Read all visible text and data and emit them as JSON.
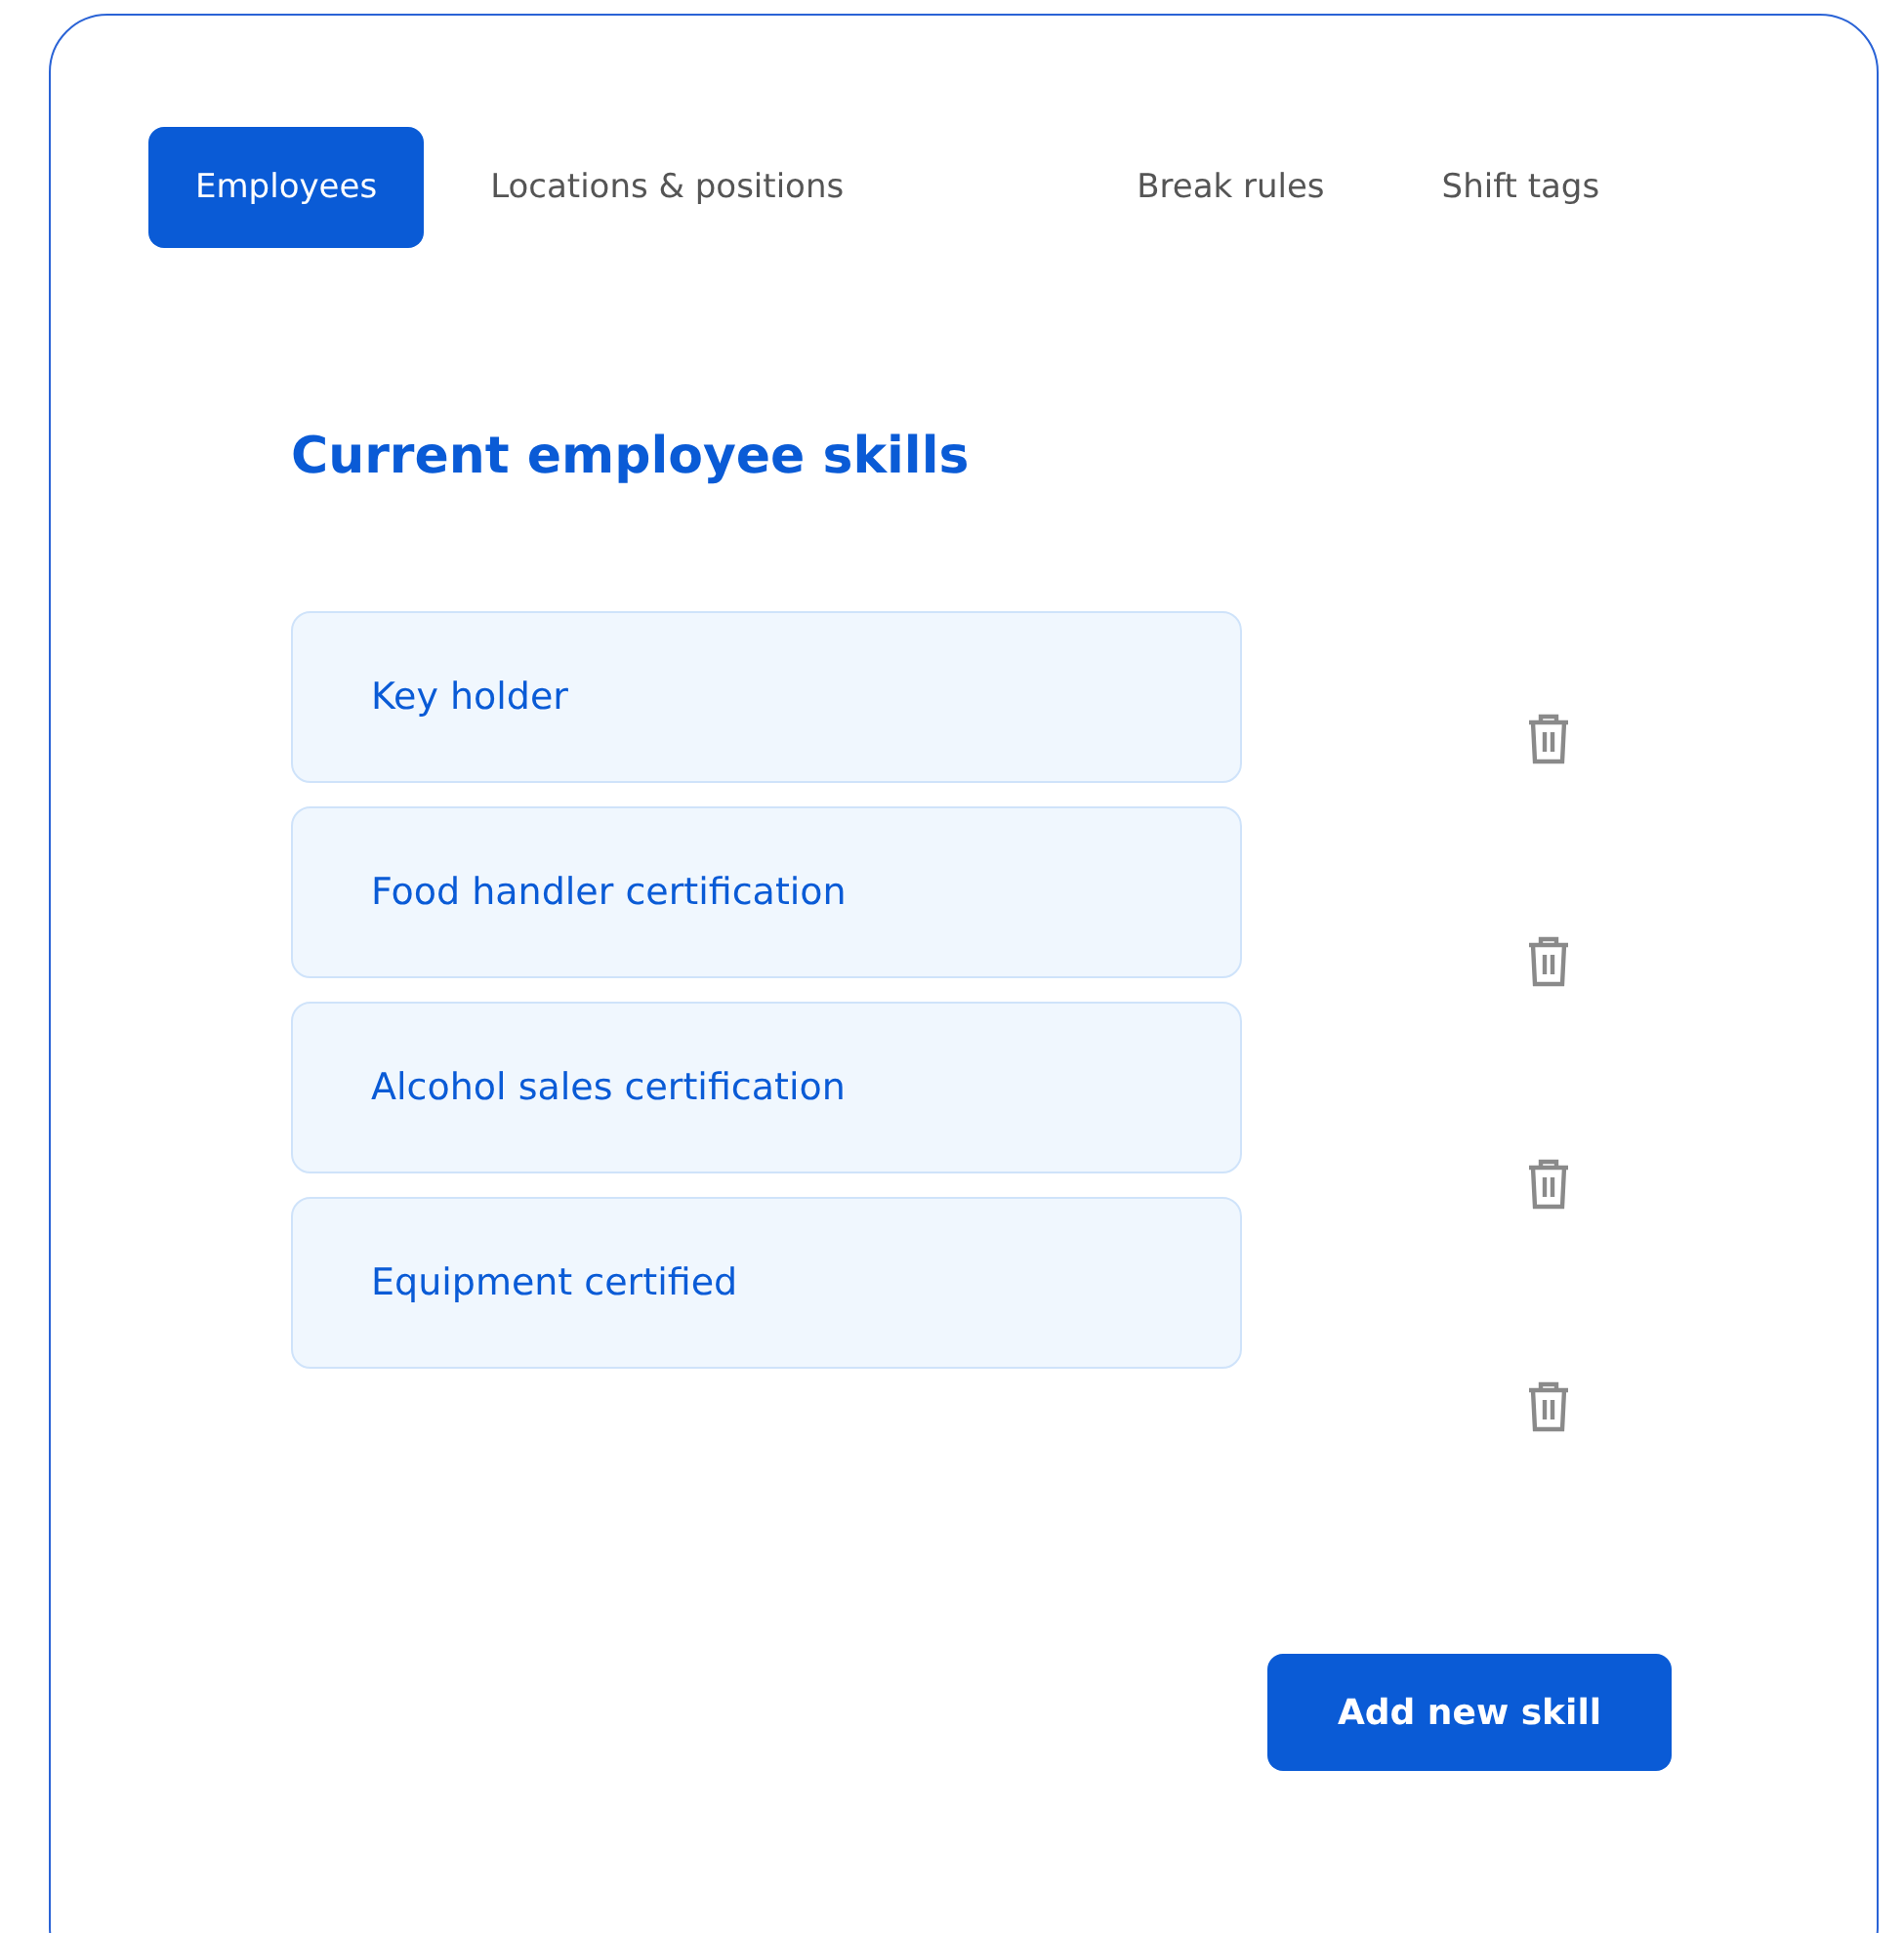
{
  "tabs": [
    {
      "label": "Employees",
      "selected": true
    },
    {
      "label": "Locations & positions",
      "selected": false
    },
    {
      "label": "Break rules",
      "selected": false
    },
    {
      "label": "Shift tags",
      "selected": false
    }
  ],
  "heading": "Current employee skills",
  "skills": [
    {
      "name": "Key holder"
    },
    {
      "name": "Food handler certification"
    },
    {
      "name": "Alcohol sales certification"
    },
    {
      "name": "Equipment certified"
    }
  ],
  "add_button": "Add new skill"
}
